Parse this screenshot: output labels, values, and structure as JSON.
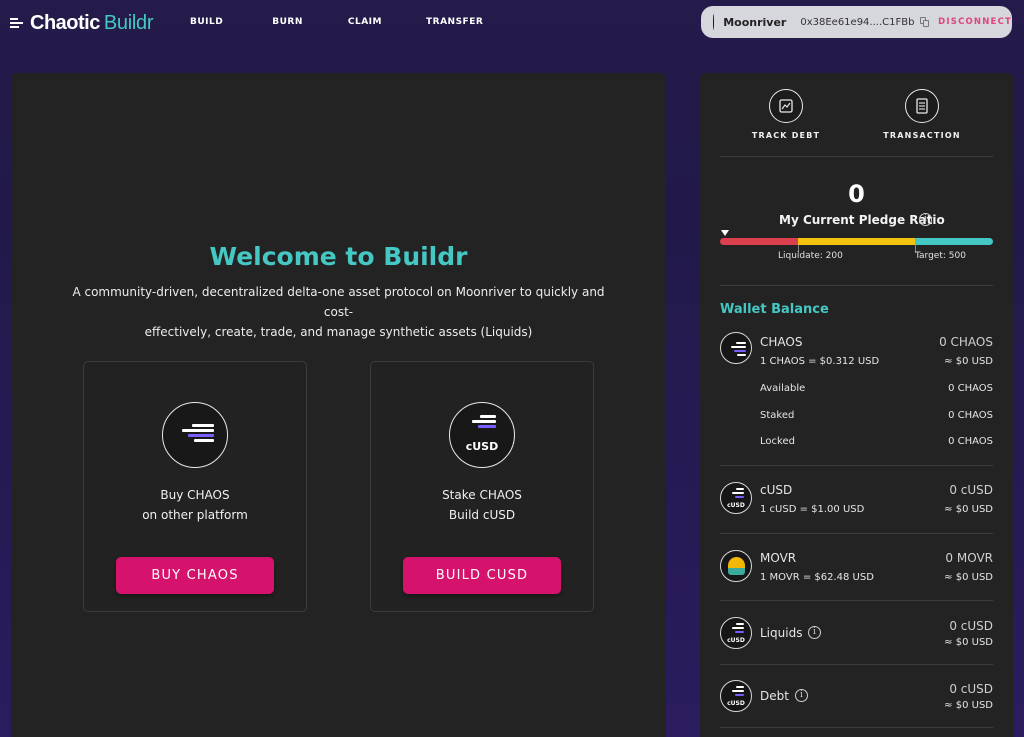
{
  "header": {
    "logo_part1": "Chaotic",
    "logo_part2": "Buildr",
    "nav": [
      "BUILD",
      "BURN",
      "CLAIM",
      "TRANSFER"
    ],
    "wallet": {
      "network": "Moonriver",
      "address": "0x38Ee61e94....C1FBb",
      "disconnect_label": "DISCONNECT"
    }
  },
  "main": {
    "title": "Welcome to Buildr",
    "subtitle_line1": "A community-driven, decentralized delta-one asset protocol on Moonriver to quickly and cost-",
    "subtitle_line2": "effectively, create, trade, and manage synthetic assets (Liquids)",
    "cards": [
      {
        "line1": "Buy CHAOS",
        "line2": "on other platform",
        "button": "BUY CHAOS"
      },
      {
        "line1": "Stake CHAOS",
        "line2": "Build cUSD",
        "button": "BUILD CUSD",
        "icon_label": "cUSD"
      }
    ]
  },
  "side": {
    "actions": [
      "TRACK DEBT",
      "TRANSACTION"
    ],
    "pledge_ratio": "0",
    "pledge_label": "My Current Pledge Ratio",
    "liquidate_label": "Liquidate: 200",
    "target_label": "Target: 500",
    "wallet_title": "Wallet Balance",
    "chaos": {
      "name": "CHAOS",
      "rate": "1 CHAOS = $0.312 USD",
      "amount": "0 CHAOS",
      "usd": "≈ $0 USD",
      "details": [
        {
          "label": "Available",
          "value": "0 CHAOS"
        },
        {
          "label": "Staked",
          "value": "0 CHAOS"
        },
        {
          "label": "Locked",
          "value": "0 CHAOS"
        }
      ]
    },
    "cusd": {
      "name": "cUSD",
      "rate": "1 cUSD = $1.00 USD",
      "amount": "0 cUSD",
      "usd": "≈ $0 USD",
      "icon_label": "cUSD"
    },
    "movr": {
      "name": "MOVR",
      "rate": "1 MOVR = $62.48 USD",
      "amount": "0 MOVR",
      "usd": "≈ $0 USD"
    },
    "liquids": {
      "name": "Liquids",
      "amount": "0 cUSD",
      "usd": "≈ $0 USD",
      "icon_label": "cUSD"
    },
    "debt": {
      "name": "Debt",
      "amount": "0 cUSD",
      "usd": "≈ $0 USD",
      "icon_label": "cUSD"
    }
  },
  "colors": {
    "accent_teal": "#45c8c4",
    "button_pink": "#d5126c",
    "disconnect_red": "#e0457a",
    "bar_red": "#dc3f4d",
    "bar_yellow": "#f2c40f"
  }
}
